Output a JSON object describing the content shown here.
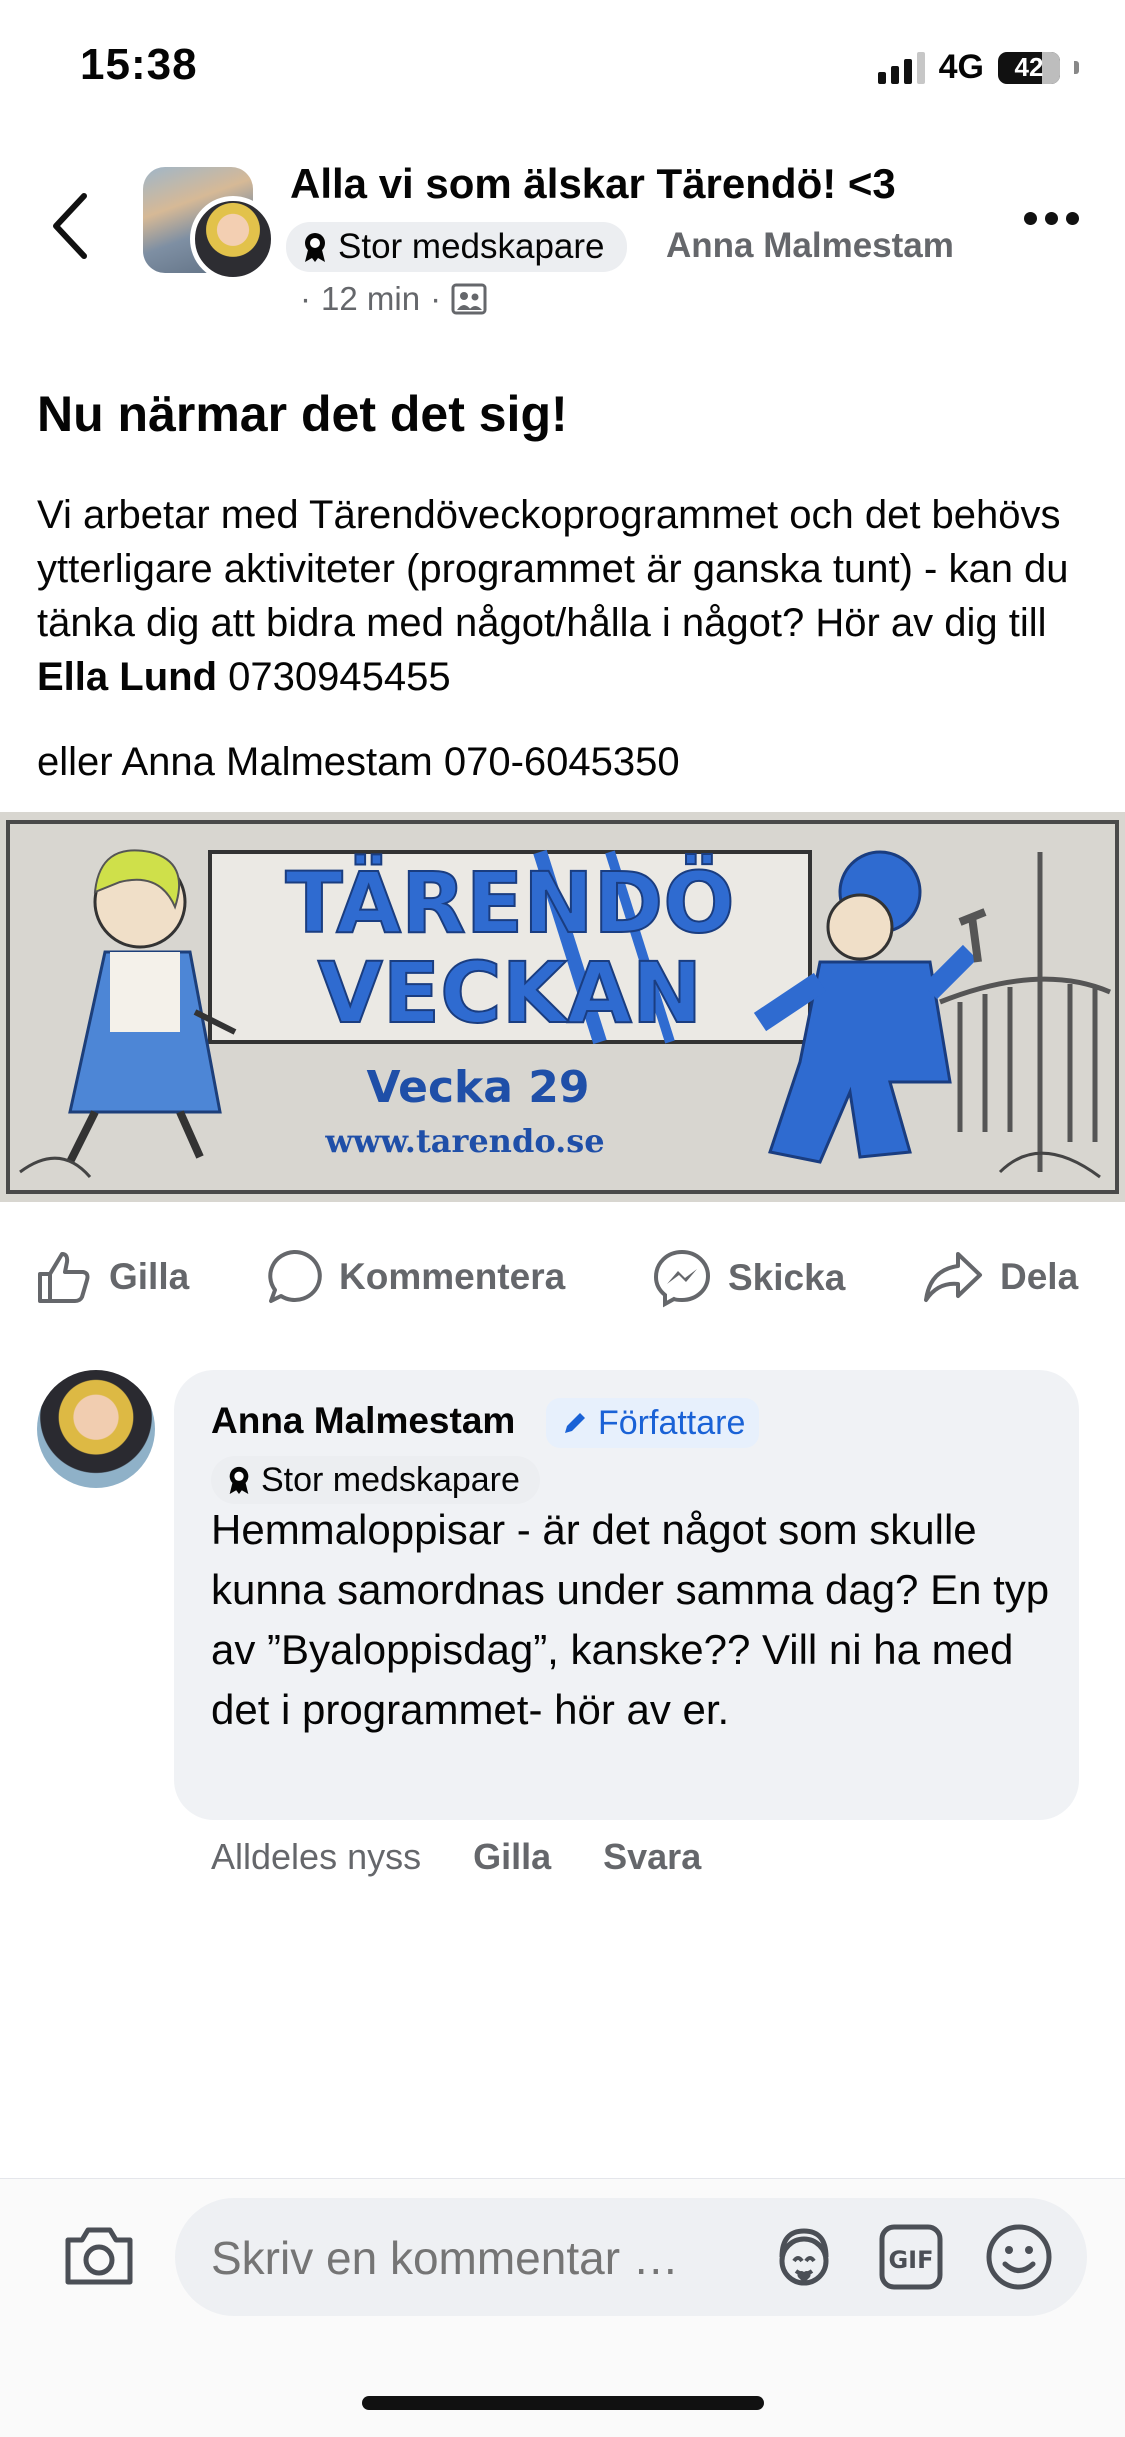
{
  "status_bar": {
    "time": "15:38",
    "network": "4G",
    "battery": "42"
  },
  "header": {
    "group_title": "Alla vi som älskar Tärendö! <3",
    "badge": "Stor medskapare",
    "author": "Anna Malmestam",
    "time": "12 min"
  },
  "post": {
    "heading": "Nu närmar det det sig!",
    "body_before_bold": "Vi arbetar med Tärendöveckoprogrammet och det behövs ytterligare aktiviteter (programmet är ganska tunt) - kan du tänka dig att bidra med något/hålla i något? Hör av dig till ",
    "body_bold": "Ella Lund",
    "body_after_bold": " 0730945455",
    "body2": "eller Anna Malmestam 070-6045350",
    "image": {
      "title_line1": "TÄRENDÖ",
      "title_line2": "VECKAN",
      "week": "Vecka 29",
      "url": "www.tarendo.se"
    }
  },
  "actions": {
    "like": "Gilla",
    "comment": "Kommentera",
    "send": "Skicka",
    "share": "Dela"
  },
  "comment": {
    "name": "Anna Malmestam",
    "author_tag": "Författare",
    "badge": "Stor medskapare",
    "text": "Hemmaloppisar - är det något som skulle kunna samordnas under samma dag? En typ av ”Byaloppisdag”, kanske?? Vill ni ha med det i programmet- hör av er.",
    "time": "Alldeles nyss",
    "like": "Gilla",
    "reply": "Svara"
  },
  "composer": {
    "placeholder": "Skriv en kommentar …",
    "gif_label": "GIF"
  },
  "colors": {
    "text": "#050505",
    "secondary": "#65676b",
    "accent_blue": "#1a62d6",
    "bubble": "#f0f2f5",
    "banner_blue": "#2f6bd0"
  }
}
